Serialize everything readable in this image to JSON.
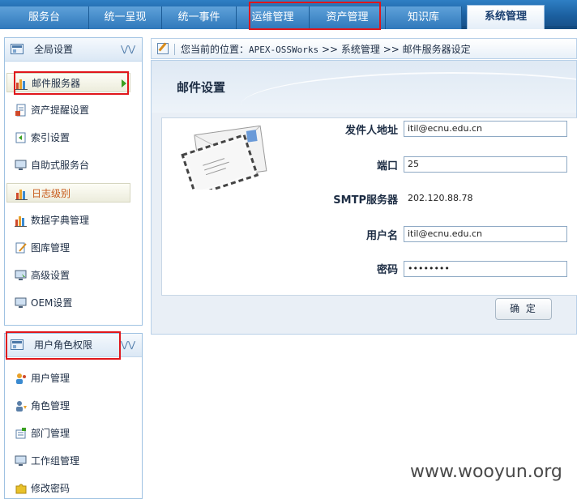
{
  "top_tabs": [
    {
      "label": "服务台"
    },
    {
      "label": "统一呈现"
    },
    {
      "label": "统一事件"
    },
    {
      "label": "运维管理"
    },
    {
      "label": "资产管理"
    },
    {
      "label": "知识库"
    },
    {
      "label": "系统管理",
      "active": true
    }
  ],
  "sidebar": {
    "global_settings": {
      "title": "全局设置",
      "items": [
        {
          "label": "邮件服务器",
          "icon": "chart-icon",
          "selected": true
        },
        {
          "label": "资产提醒设置",
          "icon": "document-icon"
        },
        {
          "label": "索引设置",
          "icon": "index-icon"
        },
        {
          "label": "自助式服务台",
          "icon": "monitor-icon"
        },
        {
          "label": "日志级别",
          "icon": "chart-icon"
        },
        {
          "label": "数据字典管理",
          "icon": "chart-icon"
        },
        {
          "label": "图库管理",
          "icon": "edit-icon"
        },
        {
          "label": "高级设置",
          "icon": "monitor-icon"
        },
        {
          "label": "OEM设置",
          "icon": "monitor-icon"
        }
      ]
    },
    "user_roles": {
      "title": "用户角色权限",
      "items": [
        {
          "label": "用户管理",
          "icon": "user-icon"
        },
        {
          "label": "角色管理",
          "icon": "role-icon"
        },
        {
          "label": "部门管理",
          "icon": "department-icon"
        },
        {
          "label": "工作组管理",
          "icon": "monitor-icon"
        },
        {
          "label": "修改密码",
          "icon": "puzzle-icon"
        }
      ]
    }
  },
  "breadcrumb": {
    "prefix": "您当前的位置：",
    "root": "APEX-OSSWorks",
    "separator": ">>",
    "level1": "系统管理",
    "level2": "邮件服务器设定"
  },
  "mail_settings": {
    "title": "邮件设置",
    "fields": [
      {
        "label": "发件人地址",
        "value": "itil@ecnu.edu.cn"
      },
      {
        "label": "端口",
        "value": "25"
      },
      {
        "label": "SMTP服务器",
        "value": "202.120.88.78"
      },
      {
        "label": "用户名",
        "value": "itil@ecnu.edu.cn"
      },
      {
        "label": "密码",
        "value": "••••••••"
      }
    ],
    "confirm_button": "确 定"
  },
  "watermark": "www.wooyun.org",
  "colors": {
    "nav_bg": "#1b5f9f",
    "highlight_box": "#e0161b",
    "log_level_text": "#c75a1a"
  }
}
